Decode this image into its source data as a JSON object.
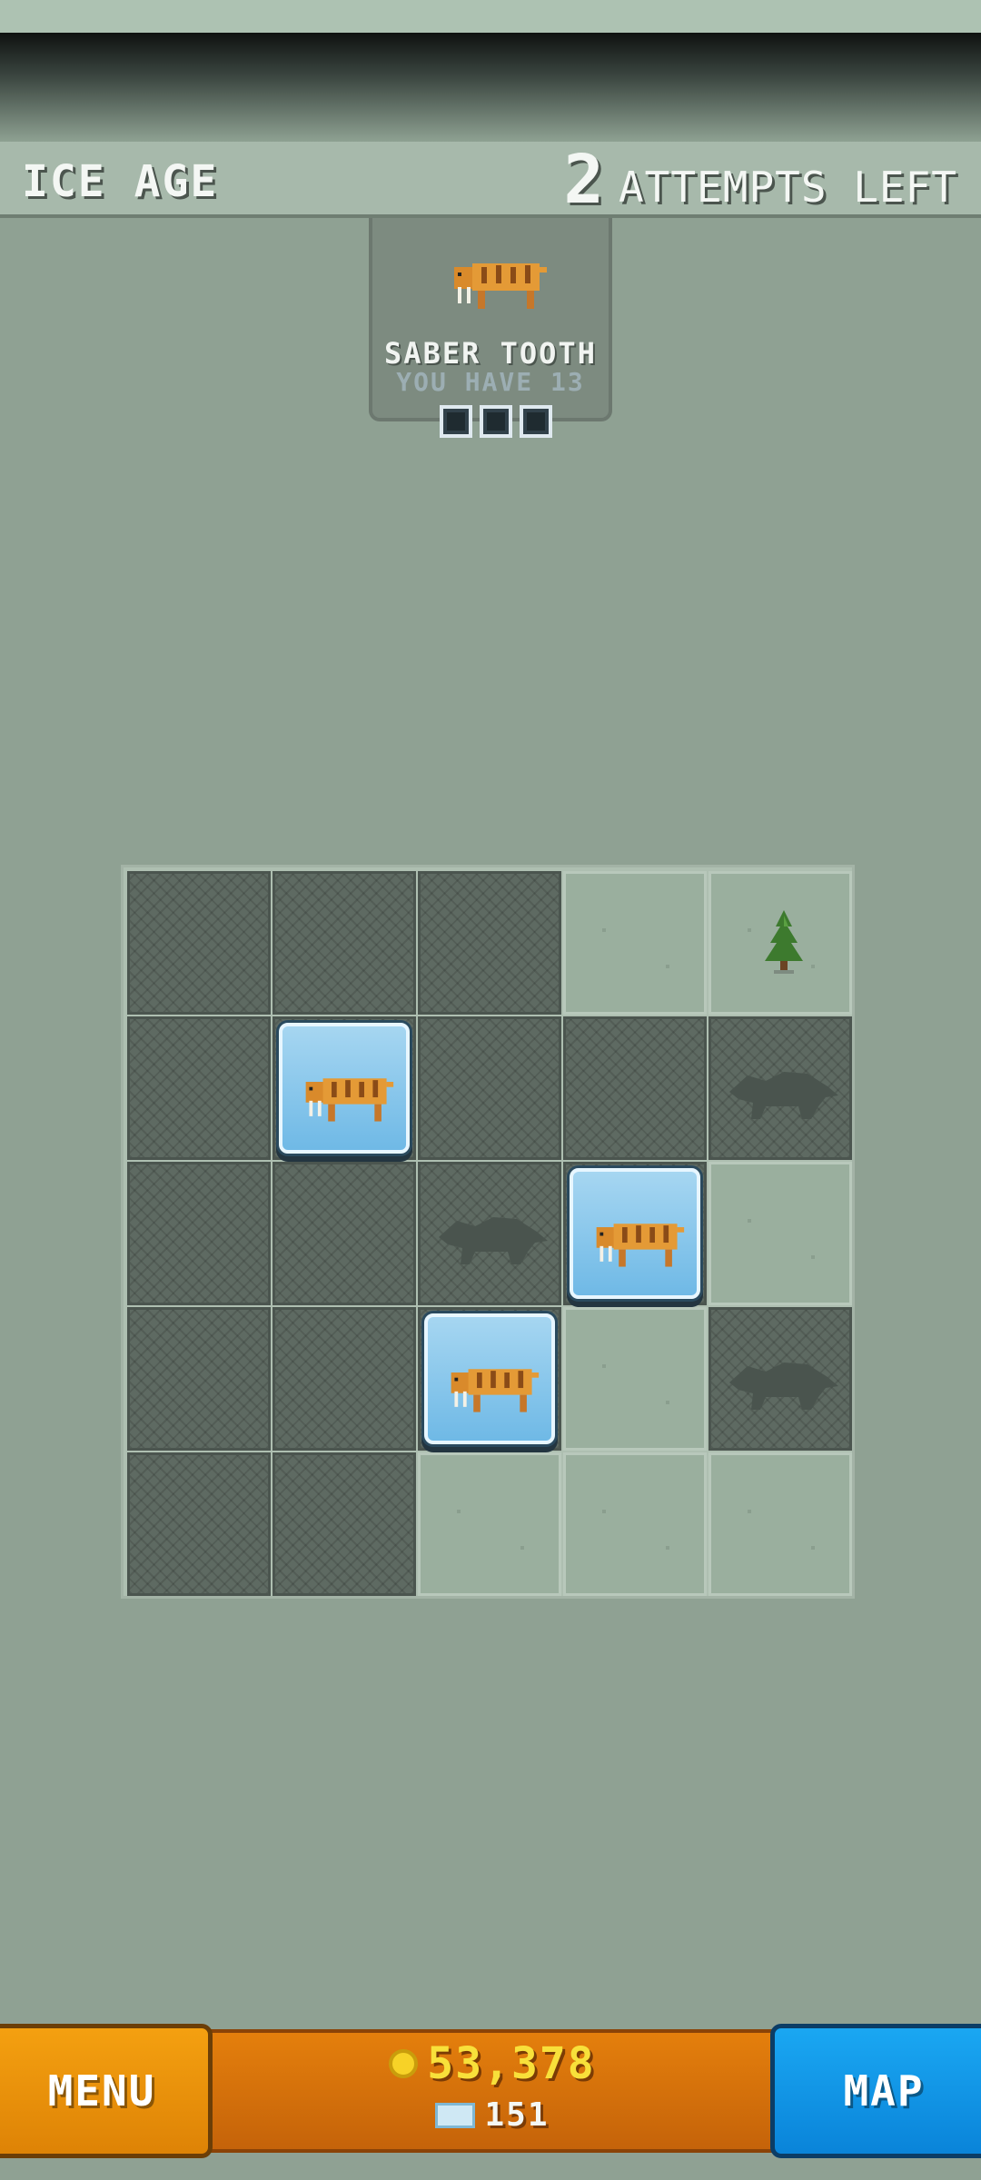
{
  "header": {
    "level_name": "ICE AGE",
    "attempts_count": "2",
    "attempts_label": "ATTEMPTS LEFT"
  },
  "goal": {
    "animal_name": "SABER TOOTH",
    "subtitle": "YOU HAVE 13",
    "progress_boxes": 3
  },
  "board": {
    "rows": 5,
    "cols": 5,
    "cells": [
      [
        "locked",
        "locked",
        "locked",
        "ground",
        "ground-tree"
      ],
      [
        "locked",
        "saber-tile",
        "locked",
        "locked",
        "locked-shadow"
      ],
      [
        "locked",
        "locked",
        "locked-shadow",
        "saber-tile",
        "ground"
      ],
      [
        "locked",
        "locked",
        "saber-tile",
        "ground",
        "locked-shadow"
      ],
      [
        "locked",
        "locked",
        "ground",
        "ground",
        "ground"
      ]
    ]
  },
  "footer": {
    "menu_label": "MENU",
    "map_label": "MAP",
    "coins": "53,378",
    "gems": "151"
  },
  "colors": {
    "background": "#8fa193",
    "coin": "#f8e03a",
    "menu_orange": "#f4a010",
    "map_blue": "#1aa7f2"
  },
  "icons": [
    "saber-tooth-icon",
    "tree-icon",
    "animal-silhouette-icon",
    "coin-icon",
    "gem-icon"
  ]
}
